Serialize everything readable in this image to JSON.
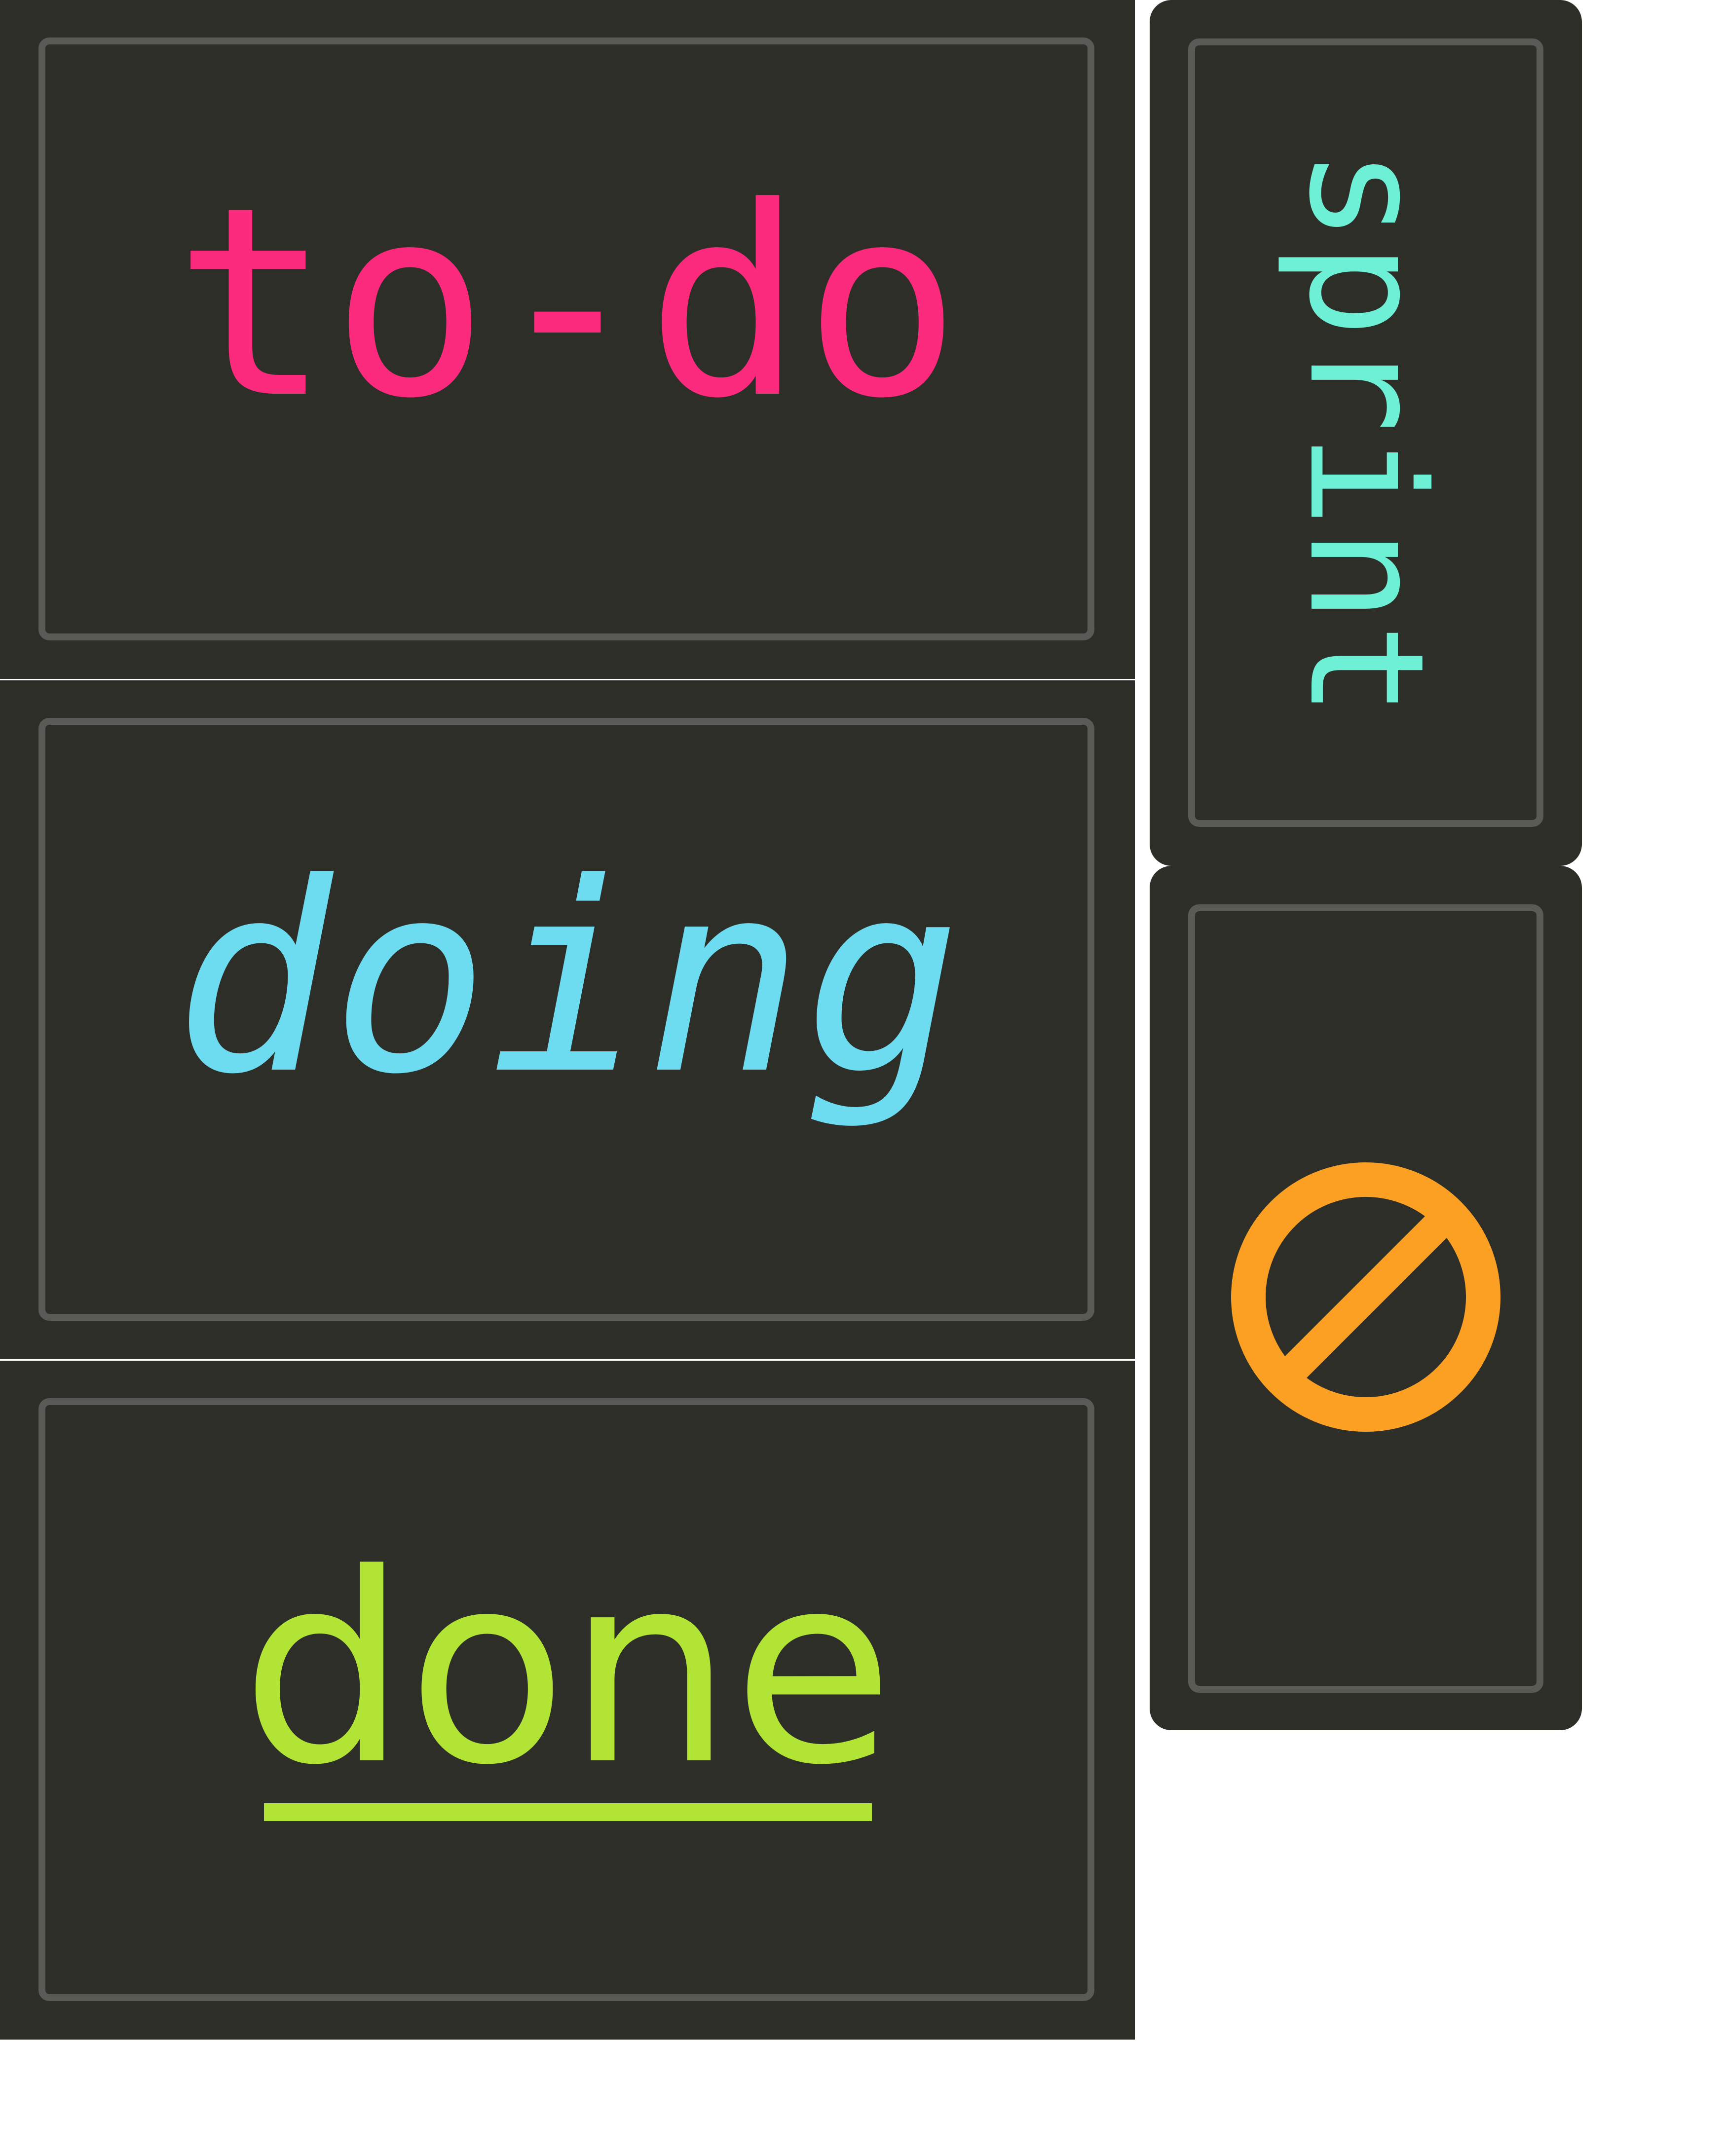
{
  "cards": {
    "todo": {
      "label": "to-do",
      "color": "#fb2a7c"
    },
    "doing": {
      "label": "doing",
      "color": "#6edcf0"
    },
    "done": {
      "label": "done",
      "color": "#b1e434"
    },
    "sprint": {
      "label": "sprint",
      "color": "#6df0d6"
    },
    "blocked": {
      "icon": "prohibited-icon",
      "color": "#fca023"
    }
  },
  "colors": {
    "panel": "#2d2e28",
    "inner_border": "#5a5b56",
    "background": "#ffffff"
  }
}
